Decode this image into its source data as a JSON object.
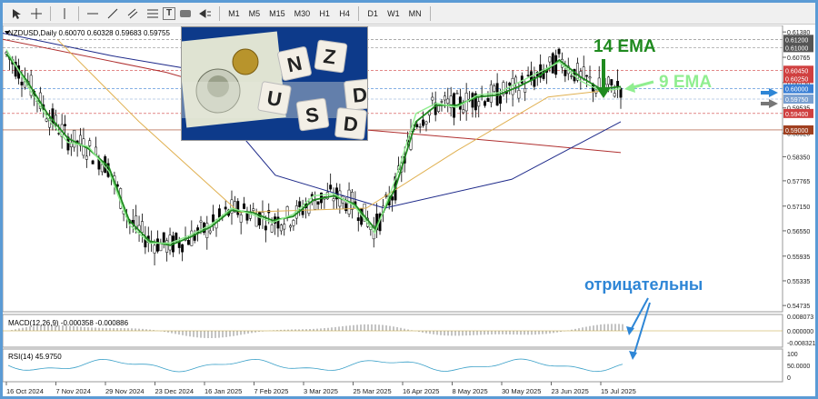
{
  "toolbar": {
    "timeframes": [
      "M1",
      "M5",
      "M15",
      "M30",
      "H1",
      "H4",
      "D1",
      "W1",
      "MN"
    ]
  },
  "chart_header": "NZDUSD,Daily  0.60070 0.60328 0.59683 0.59755",
  "annotations": {
    "ema14": "14 EMA",
    "ema9": "9 EMA",
    "negative": "отрицательны"
  },
  "macd_label": "MACD(12,26,9) -0.000358 -0.000886",
  "rsi_label": "RSI(14) 45.9750",
  "photo_tiles": [
    "N",
    "Z",
    "D",
    "U",
    "S",
    "D"
  ],
  "colors": {
    "accent": "#5b9bd5",
    "ema14": "#1f8a1f",
    "ema9": "#90ee90",
    "annotation_blue": "#2e86d6"
  },
  "price_axis": {
    "ticks": [
      "0.61380",
      "0.60765",
      "0.60150",
      "0.59535",
      "0.58920",
      "0.58350",
      "0.57765",
      "0.57150",
      "0.56550",
      "0.55935",
      "0.55335",
      "0.54735"
    ],
    "tags": [
      {
        "value": "0.61200",
        "color": "#555555"
      },
      {
        "value": "0.61000",
        "color": "#555555"
      },
      {
        "value": "0.60450",
        "color": "#d04040"
      },
      {
        "value": "0.60250",
        "color": "#d04040"
      },
      {
        "value": "0.60000",
        "color": "#3a7fd5"
      },
      {
        "value": "0.59750",
        "color": "#7aa0d0"
      },
      {
        "value": "0.59400",
        "color": "#d04040"
      },
      {
        "value": "0.59000",
        "color": "#a04020"
      }
    ]
  },
  "macd_axis": [
    "0.008073",
    "0.000000",
    "-0.008321"
  ],
  "rsi_axis": [
    "100",
    "50.0000",
    "0"
  ],
  "date_axis": [
    "16 Oct 2024",
    "7 Nov 2024",
    "29 Nov 2024",
    "23 Dec 2024",
    "16 Jan 2025",
    "7 Feb 2025",
    "3 Mar 2025",
    "25 Mar 2025",
    "16 Apr 2025",
    "8 May 2025",
    "30 May 2025",
    "23 Jun 2025",
    "15 Jul 2025"
  ],
  "chart_data": {
    "type": "line",
    "title": "NZDUSD,Daily",
    "ylim": [
      0.5465,
      0.6145
    ],
    "series": [
      {
        "name": "14 EMA",
        "values": [
          0.6085,
          0.602,
          0.594,
          0.588,
          0.5855,
          0.581,
          0.568,
          0.563,
          0.562,
          0.564,
          0.5665,
          0.5705,
          0.57,
          0.568,
          0.569,
          0.573,
          0.574,
          0.572,
          0.566,
          0.576,
          0.592,
          0.596,
          0.596,
          0.598,
          0.5985,
          0.6005,
          0.603,
          0.607,
          0.603,
          0.6,
          0.6005
        ]
      },
      {
        "name": "9 EMA",
        "values": [
          0.6095,
          0.601,
          0.593,
          0.587,
          0.586,
          0.58,
          0.567,
          0.5625,
          0.5625,
          0.5645,
          0.567,
          0.571,
          0.5695,
          0.5675,
          0.5695,
          0.574,
          0.5745,
          0.5715,
          0.565,
          0.578,
          0.594,
          0.5965,
          0.5955,
          0.5985,
          0.599,
          0.6015,
          0.604,
          0.6065,
          0.602,
          0.5995,
          0.6
        ]
      }
    ]
  }
}
